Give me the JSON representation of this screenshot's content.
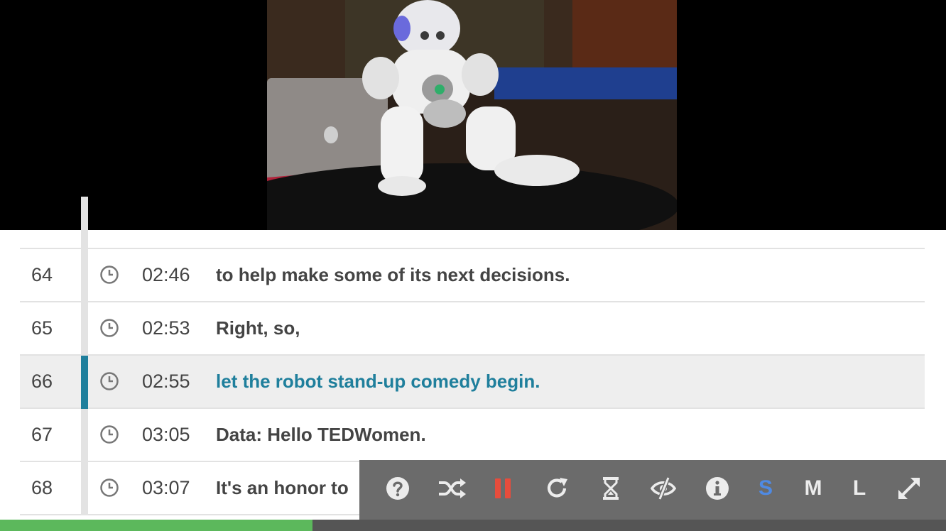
{
  "transcript": {
    "rows": [
      {
        "num": "64",
        "time": "02:46",
        "text": "to help make some of its next decisions.",
        "active": false
      },
      {
        "num": "65",
        "time": "02:53",
        "text": "Right, so,",
        "active": false
      },
      {
        "num": "66",
        "time": "02:55",
        "text": "let the robot stand-up comedy begin.",
        "active": true
      },
      {
        "num": "67",
        "time": "03:05",
        "text": "Data: Hello TEDWomen.",
        "active": false
      },
      {
        "num": "68",
        "time": "03:07",
        "text": "It's an honor to",
        "active": false
      }
    ]
  },
  "controls": {
    "icons": [
      "help-icon",
      "shuffle-icon",
      "pause-icon",
      "refresh-icon",
      "hourglass-icon",
      "eye-slash-icon",
      "info-icon",
      "expand-icon"
    ],
    "size_small": "S",
    "size_medium": "M",
    "size_large": "L",
    "selected_size": "S",
    "pause_color": "#e74c3c",
    "selected_color": "#4f8ae3"
  },
  "progress": {
    "fraction": 0.33
  },
  "colors": {
    "accent": "#1f7f9c",
    "progress": "#5cb85c",
    "control_bar": "#6b6b6b"
  }
}
